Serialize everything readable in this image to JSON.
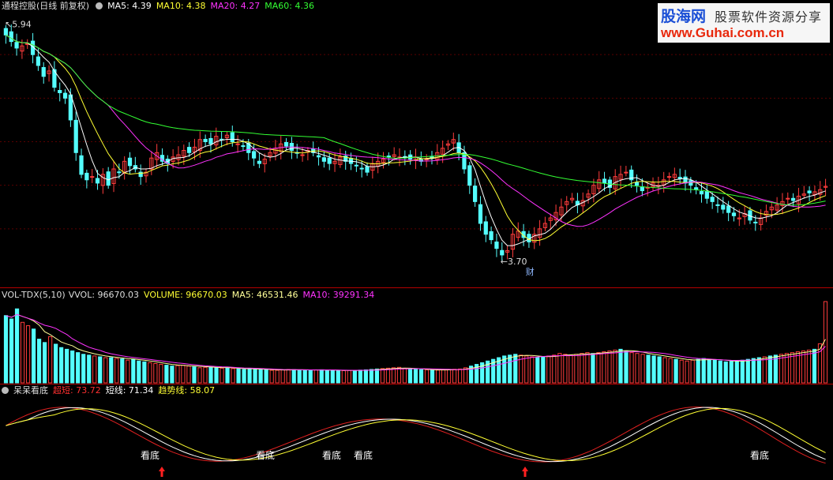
{
  "header": {
    "title": "通程控股(日线 前复权)",
    "ma5": "MA5: 4.39",
    "ma10": "MA10: 4.38",
    "ma20": "MA20: 4.27",
    "ma60": "MA60: 4.36"
  },
  "volume_header": {
    "name": "VOL-TDX(5,10)",
    "vvol": "VVOL: 96670.03",
    "volume": "VOLUME: 96670.03",
    "ma5": "MA5: 46531.46",
    "ma10": "MA10: 39291.34"
  },
  "indicator_header": {
    "name": "呆呆看底",
    "chaoduan": "超短: 73.72",
    "duanxian": "短线: 71.34",
    "qushi": "趋势线: 58.07"
  },
  "watermark": {
    "brand": "股海网",
    "slogan": "股票软件资源分享",
    "url": "www.Guhai.com.cn"
  },
  "colors": {
    "up": "#ff3c3c",
    "down": "#54ffff",
    "ma5": "#ffffff",
    "ma10": "#ffff33",
    "ma20": "#ff33ff",
    "ma60": "#33ff33",
    "separator": "#b40000"
  },
  "chart_data": [
    {
      "type": "candlestick",
      "title": "通程控股(日线 前复权)",
      "series": [
        {
          "name": "MA5",
          "last": 4.39
        },
        {
          "name": "MA10",
          "last": 4.38
        },
        {
          "name": "MA20",
          "last": 4.27
        },
        {
          "name": "MA60",
          "last": 4.36
        }
      ],
      "close": [
        5.78,
        5.72,
        5.66,
        5.68,
        5.7,
        5.6,
        5.5,
        5.4,
        5.45,
        5.3,
        5.25,
        5.2,
        5.0,
        4.7,
        4.5,
        4.45,
        4.48,
        4.42,
        4.5,
        4.4,
        4.55,
        4.52,
        4.62,
        4.58,
        4.55,
        4.48,
        4.52,
        4.65,
        4.7,
        4.62,
        4.6,
        4.66,
        4.68,
        4.72,
        4.7,
        4.75,
        4.82,
        4.8,
        4.78,
        4.85,
        4.82,
        4.86,
        4.8,
        4.78,
        4.76,
        4.7,
        4.65,
        4.6,
        4.64,
        4.7,
        4.74,
        4.78,
        4.76,
        4.72,
        4.7,
        4.68,
        4.72,
        4.7,
        4.66,
        4.62,
        4.6,
        4.62,
        4.66,
        4.62,
        4.6,
        4.58,
        4.55,
        4.52,
        4.6,
        4.62,
        4.64,
        4.66,
        4.68,
        4.66,
        4.65,
        4.64,
        4.66,
        4.62,
        4.64,
        4.66,
        4.7,
        4.74,
        4.78,
        4.82,
        4.7,
        4.55,
        4.4,
        4.25,
        4.05,
        3.95,
        3.9,
        3.82,
        3.76,
        3.8,
        3.95,
        3.98,
        3.92,
        3.88,
        3.95,
        4.0,
        4.05,
        4.1,
        4.15,
        4.2,
        4.25,
        4.28,
        4.22,
        4.26,
        4.32,
        4.4,
        4.45,
        4.42,
        4.38,
        4.48,
        4.5,
        4.52,
        4.45,
        4.4,
        4.35,
        4.38,
        4.42,
        4.4,
        4.45,
        4.48,
        4.5,
        4.46,
        4.42,
        4.4,
        4.36,
        4.32,
        4.28,
        4.25,
        4.22,
        4.18,
        4.15,
        4.12,
        4.1,
        4.14,
        4.08,
        4.06,
        4.1,
        4.16,
        4.2,
        4.22,
        4.25,
        4.28,
        4.26,
        4.3,
        4.32,
        4.33,
        4.34,
        4.36,
        4.39
      ],
      "markers": [
        {
          "label": "5.94",
          "value": 5.94
        },
        {
          "label": "3.70",
          "value": 3.7
        },
        {
          "label": "财",
          "value": 3.7
        }
      ]
    },
    {
      "type": "bar",
      "title": "VOL-TDX(5,10)",
      "series": [
        {
          "name": "VVOL",
          "last": 96670.03
        },
        {
          "name": "VOLUME",
          "last": 96670.03
        },
        {
          "name": "MA5",
          "last": 46531.46
        },
        {
          "name": "MA10",
          "last": 39291.34
        }
      ],
      "values": [
        80000,
        76000,
        88000,
        72000,
        68000,
        64000,
        52000,
        48000,
        55000,
        46000,
        42000,
        40000,
        38000,
        36000,
        34000,
        33000,
        32000,
        31000,
        30000,
        30000,
        29000,
        28500,
        27000,
        28000,
        26000,
        25000,
        24000,
        23000,
        22000,
        21000,
        20000,
        20500,
        21000,
        20000,
        19000,
        18000,
        18500,
        19000,
        18000,
        17500,
        18000,
        17000,
        16500,
        16000,
        17000,
        16500,
        16000,
        15500,
        15000,
        15000,
        15500,
        16000,
        15800,
        15500,
        15200,
        15000,
        15500,
        15600,
        15000,
        14800,
        14500,
        14600,
        14800,
        15000,
        15200,
        15500,
        16000,
        16500,
        17000,
        17500,
        18000,
        18500,
        17000,
        16500,
        16000,
        15800,
        15500,
        15000,
        15200,
        15600,
        16000,
        16200,
        16500,
        18000,
        20000,
        22000,
        24000,
        26000,
        28000,
        30000,
        32000,
        33000,
        34000,
        33000,
        32000,
        31000,
        30000,
        31000,
        32000,
        33000,
        35000,
        34000,
        33000,
        34000,
        35000,
        36000,
        35000,
        36000,
        37000,
        38000,
        39000,
        40000,
        38000,
        36000,
        35000,
        34000,
        33000,
        32000,
        31000,
        30000,
        29000,
        28000,
        27000,
        26000,
        27000,
        28000,
        29000,
        28000,
        27000,
        26000,
        25000,
        25500,
        26000,
        27000,
        28000,
        29000,
        30000,
        31000,
        32000,
        33000,
        34000,
        35000,
        36000,
        37000,
        38000,
        39000,
        40000,
        46531,
        96670
      ]
    },
    {
      "type": "line",
      "title": "呆呆看底",
      "series": [
        {
          "name": "超短",
          "last": 73.72
        },
        {
          "name": "短线",
          "last": 71.34
        },
        {
          "name": "趋势线",
          "last": 58.07
        }
      ],
      "annotations": [
        "看底",
        "看底",
        "看底",
        "看底",
        "看底"
      ]
    }
  ]
}
